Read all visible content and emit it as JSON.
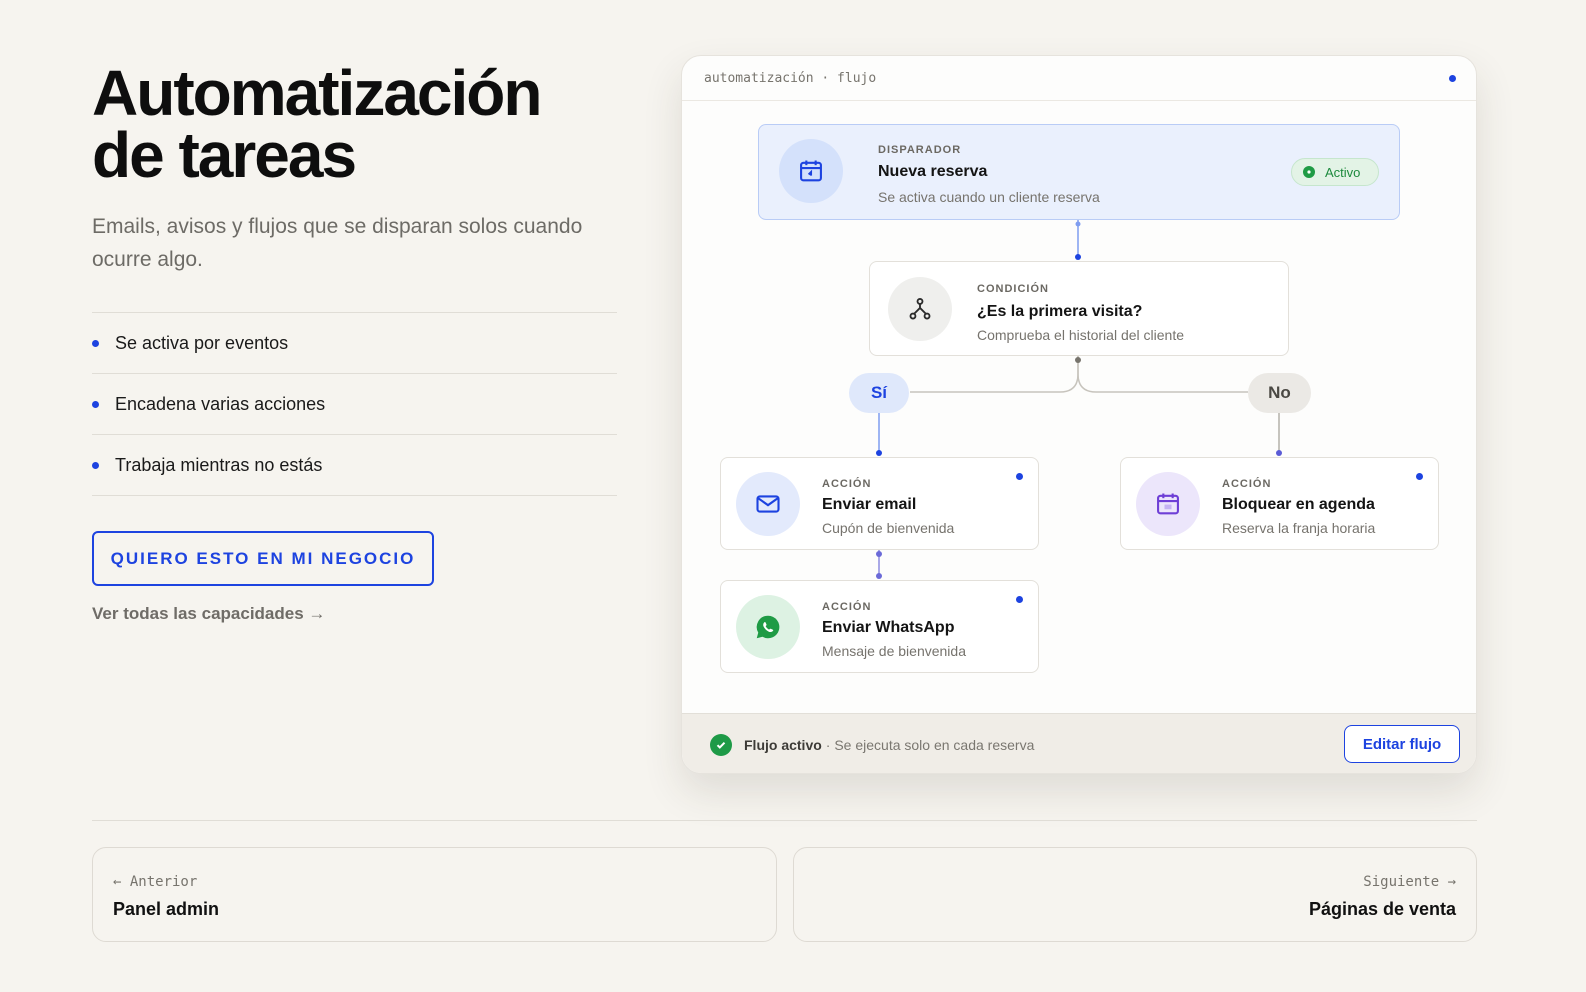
{
  "hero": {
    "title_line1": "Automatización",
    "title_line2": "de tareas",
    "subtitle": "Emails, avisos y flujos que se disparan solos cuando ocurre algo.",
    "features": [
      "Se activa por eventos",
      "Encadena varias acciones",
      "Trabaja mientras no estás"
    ],
    "cta_label": "QUIERO ESTO EN MI NEGOCIO",
    "more_link": "Ver todas las capacidades →"
  },
  "flow": {
    "header_path": "automatización · flujo",
    "trigger": {
      "kicker": "DISPARADOR",
      "title": "Nueva reserva",
      "desc": "Se activa cuando un cliente reserva",
      "status": "Activo",
      "icon": "calendar-icon"
    },
    "condition": {
      "kicker": "CONDICIÓN",
      "title": "¿Es la primera visita?",
      "desc": "Comprueba el historial del cliente",
      "icon": "branch-icon"
    },
    "branch_yes": "Sí",
    "branch_no": "No",
    "actions": [
      {
        "kicker": "ACCIÓN",
        "title": "Enviar email",
        "desc": "Cupón de bienvenida",
        "icon": "mail-icon"
      },
      {
        "kicker": "ACCIÓN",
        "title": "Bloquear en agenda",
        "desc": "Reserva la franja horaria",
        "icon": "calendar-icon"
      },
      {
        "kicker": "ACCIÓN",
        "title": "Enviar WhatsApp",
        "desc": "Mensaje de bienvenida",
        "icon": "whatsapp-icon"
      }
    ],
    "footer_status": "Flujo activo",
    "footer_desc": "· Se ejecuta solo en cada reserva",
    "edit_button": "Editar flujo"
  },
  "pagination": {
    "prev_kicker": "← Anterior",
    "prev_title": "Panel admin",
    "next_kicker": "Siguiente →",
    "next_title": "Páginas de venta"
  },
  "colors": {
    "accent": "#1d43e0",
    "success": "#1e9a47",
    "background": "#f6f4ef"
  }
}
